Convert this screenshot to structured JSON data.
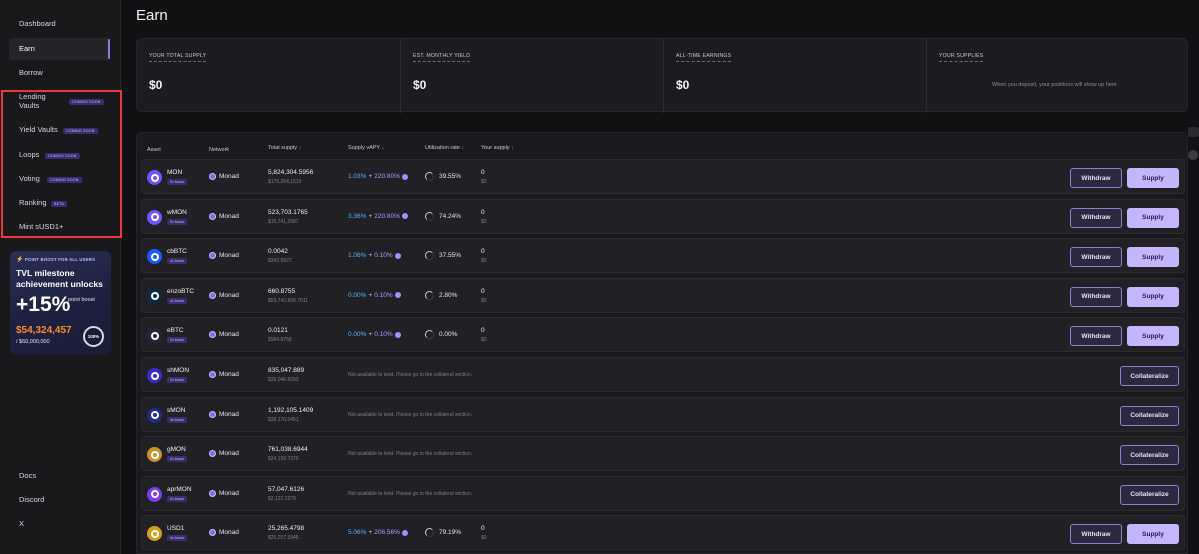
{
  "sidebar": {
    "items": [
      {
        "label": "Dashboard"
      },
      {
        "label": "Earn"
      },
      {
        "label": "Borrow"
      },
      {
        "label": "Lending Vaults",
        "badge": "COMING SOON"
      },
      {
        "label": "Yield Vaults",
        "badge": "COMING SOON"
      },
      {
        "label": "Loops",
        "badge": "COMING SOON"
      },
      {
        "label": "Voting",
        "badge": "COMING SOON"
      },
      {
        "label": "Ranking",
        "badge": "BETA"
      },
      {
        "label": "Mint sUSD1+"
      }
    ],
    "bottom": [
      {
        "label": "Docs"
      },
      {
        "label": "Discord"
      },
      {
        "label": "X"
      }
    ]
  },
  "promo": {
    "header": "POINT BOOST FOR ALL USERS",
    "title": "TVL milestone achievement unlocks",
    "percent": "+15%",
    "percent_label": "point boost",
    "amount": "$54,324,457",
    "goal": "/ $60,000,000",
    "progress_label": "100%",
    "progress": 1.0
  },
  "page": {
    "title": "Earn"
  },
  "summary": {
    "total_supply_label": "YOUR TOTAL SUPPLY",
    "total_supply_value": "$0",
    "monthly_yield_label": "EST. MONTHLY YIELD",
    "monthly_yield_value": "$0",
    "all_time_label": "ALL-TIME EARNINGS",
    "all_time_value": "$0",
    "supplies_label": "YOUR SUPPLIES",
    "supplies_empty": "When you deposit, your positions will show up here"
  },
  "table": {
    "headers": {
      "asset": "Asset",
      "network": "Network",
      "total_supply": "Total supply",
      "supply_apy": "Supply vAPY",
      "utilization": "Utilization rate",
      "your_supply": "Your supply"
    },
    "withdraw_label": "Withdraw",
    "supply_label": "Supply",
    "collateralize_label": "Collateralize",
    "not_available": "Not available to lend. Please go to the collateral section.",
    "rows": [
      {
        "asset": "MON",
        "boost": "2x boost",
        "network": "Monad",
        "total": "5,824,304.5956",
        "total_usd": "$175,264,1519",
        "base_apy": "1.03%",
        "plus": "+",
        "reward_apy": "220.80%",
        "util": "39.55%",
        "your": "0",
        "your_usd": "$0",
        "lendable": true,
        "icon_color": "#6e54ff"
      },
      {
        "asset": "wMON",
        "boost": "2x boost",
        "network": "Monad",
        "total": "523,703.1765",
        "total_usd": "$15,741,2587",
        "base_apy": "3.36%",
        "plus": "+",
        "reward_apy": "220.80%",
        "util": "74.24%",
        "your": "0",
        "your_usd": "$0",
        "lendable": true,
        "icon_color": "#6e54ff"
      },
      {
        "asset": "cbBTC",
        "boost": "4x boost",
        "network": "Monad",
        "total": "0.0042",
        "total_usd": "$342.5827",
        "base_apy": "1.06%",
        "plus": "+",
        "reward_apy": "0.10%",
        "util": "37.55%",
        "your": "0",
        "your_usd": "$0",
        "lendable": true,
        "icon_color": "#1b5cff"
      },
      {
        "asset": "enzoBTC",
        "boost": "4x boost",
        "network": "Monad",
        "total": "660.8755",
        "total_usd": "$53,742,808.7811",
        "base_apy": "0.00%",
        "plus": "+",
        "reward_apy": "0.10%",
        "util": "2.80%",
        "your": "0",
        "your_usd": "$0",
        "lendable": true,
        "icon_color": "#0d2a44"
      },
      {
        "asset": "eBTC",
        "boost": "2x boost",
        "network": "Monad",
        "total": "0.0121",
        "total_usd": "$984.8758",
        "base_apy": "0.00%",
        "plus": "+",
        "reward_apy": "0.10%",
        "util": "0.00%",
        "your": "0",
        "your_usd": "$0",
        "lendable": true,
        "icon_color": "#2a2238"
      },
      {
        "asset": "shMON",
        "boost": "2x boost",
        "network": "Monad",
        "total": "835,047.889",
        "total_usd": "$39,046.8393",
        "lendable": false,
        "icon_color": "#3b2cc9"
      },
      {
        "asset": "sMON",
        "boost": "4x boost",
        "network": "Monad",
        "total": "1,192,105.1409",
        "total_usd": "$38,170.0451",
        "lendable": false,
        "icon_color": "#1e2a8c"
      },
      {
        "asset": "gMON",
        "boost": "2x boost",
        "network": "Monad",
        "total": "761,038.6944",
        "total_usd": "$24,199.7370",
        "lendable": false,
        "icon_color": "#c9922a"
      },
      {
        "asset": "aprMON",
        "boost": "2x boost",
        "network": "Monad",
        "total": "57,047.6126",
        "total_usd": "$2,122.2279",
        "lendable": false,
        "icon_color": "#7a3cf0"
      },
      {
        "asset": "USD1",
        "boost": "4x boost",
        "network": "Monad",
        "total": "25,265.4798",
        "total_usd": "$25,257.3945",
        "base_apy": "5.06%",
        "plus": "+",
        "reward_apy": "206.56%",
        "util": "79.19%",
        "your": "0",
        "your_usd": "$0",
        "lendable": true,
        "icon_color": "#d4a017"
      }
    ]
  },
  "colors": {
    "accent": "#c4b5fd",
    "apy_base": "#4fb8ff",
    "apy_reward": "#b99bff",
    "highlight_box": "#e83a3a"
  }
}
